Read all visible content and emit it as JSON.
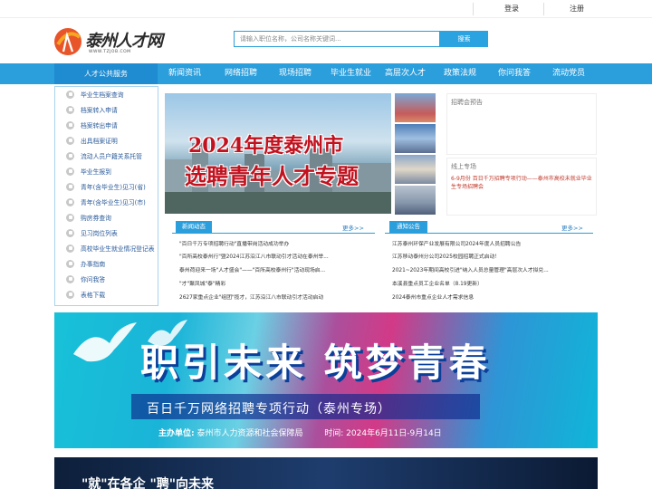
{
  "topbar": {
    "login": "登录",
    "register": "注册"
  },
  "logo": {
    "text": "泰州人才网",
    "sub": "WWW.TZJOB.COM"
  },
  "search": {
    "placeholder": "请输入职位名称，公司名称关键词...",
    "button": "搜索"
  },
  "nav": {
    "first": "人才公共服务",
    "items": [
      "新闻资讯",
      "网络招聘",
      "现场招聘",
      "毕业生就业",
      "高层次人才",
      "政策法规",
      "你问我答",
      "流动党员"
    ]
  },
  "sidebar": {
    "items": [
      "毕业生档案查询",
      "档案转入申请",
      "档案转出申请",
      "出具档案证明",
      "流动人员户籍关系托管",
      "毕业生报到",
      "青年(含毕业生)见习(省)",
      "青年(含毕业生)见习(市)",
      "购房券查询",
      "见习岗位列表",
      "高校毕业生就业情况登记表",
      "办事指南",
      "你问我答",
      "表格下载"
    ]
  },
  "banner": {
    "line1": "2024年度泰州市",
    "line2": "选聘青年人才专题"
  },
  "right": {
    "box1_title": "招聘会预告",
    "box2_title": "线上专场",
    "box2_link": "6-9月份 百日千万招聘专项行动——泰州市高校未就业毕业生专场招聘会"
  },
  "news": {
    "tab": "新闻动态",
    "more": "更多>>",
    "items": [
      "\"百日千万专项招聘行动\"直播带岗活动成功举办",
      "\"百所高校泰州行\"暨2024江苏沿江八市联动引才活动在泰州举...",
      "泰州荷迎来一场\"人才盛会\"——\"百所高校泰州行\"活动现场启...",
      "\"才\"聚凤城\"泰\"精彩",
      "2627家重点企业\"组团\"揽才，江苏沿江八市联动引才活动启动"
    ]
  },
  "notice": {
    "tab": "通知公告",
    "more": "更多>>",
    "items": [
      "江苏泰州环保产业发展有限公司2024年度人员招聘公告",
      "江苏移动泰州分公司2025校园招聘正式启动！",
      "2021~2023年期间高校引进\"纳入人员总量管理\"高层次人才拟兑...",
      "本溪县重点员工企业名单（8.19更新）",
      "2024泰州市重点企业人才需求信息"
    ]
  },
  "promo": {
    "headline": "职引未来  筑梦青春",
    "subtitle": "百日千万网络招聘专项行动（泰州专场）",
    "organizer_label": "主办单位:",
    "organizer": "泰州市人力资源和社会保障局",
    "time_label": "时间:",
    "time": "2024年6月11日-9月14日"
  },
  "promo2": {
    "text": "\"就\"在各企 \"聘\"向未来"
  }
}
